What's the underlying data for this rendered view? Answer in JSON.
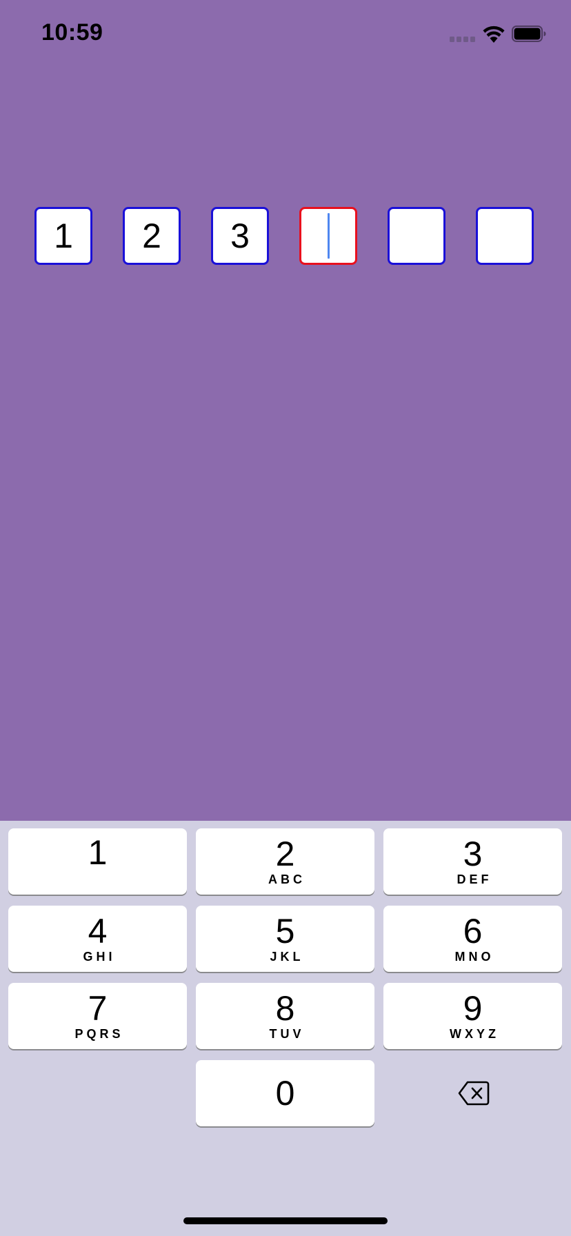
{
  "status_bar": {
    "time": "10:59",
    "icons": [
      "cellular-signal-icon",
      "wifi-icon",
      "battery-icon"
    ]
  },
  "otp": {
    "boxes": [
      {
        "value": "1",
        "state": "filled"
      },
      {
        "value": "2",
        "state": "filled"
      },
      {
        "value": "3",
        "state": "filled"
      },
      {
        "value": "",
        "state": "active"
      },
      {
        "value": "",
        "state": "empty"
      },
      {
        "value": "",
        "state": "empty"
      }
    ],
    "border_color": "#1a10d8",
    "active_border_color": "#e8101e",
    "caret_color": "#4f86f0"
  },
  "keypad": {
    "keys": [
      {
        "digit": "1",
        "letters": ""
      },
      {
        "digit": "2",
        "letters": "ABC"
      },
      {
        "digit": "3",
        "letters": "DEF"
      },
      {
        "digit": "4",
        "letters": "GHI"
      },
      {
        "digit": "5",
        "letters": "JKL"
      },
      {
        "digit": "6",
        "letters": "MNO"
      },
      {
        "digit": "7",
        "letters": "PQRS"
      },
      {
        "digit": "8",
        "letters": "TUV"
      },
      {
        "digit": "9",
        "letters": "WXYZ"
      },
      {
        "digit": "0",
        "letters": ""
      }
    ],
    "delete_icon": "delete-backspace-icon"
  },
  "colors": {
    "background": "#8c6bad",
    "keyboard_background": "#d1cfe2",
    "key_background": "#ffffff"
  }
}
